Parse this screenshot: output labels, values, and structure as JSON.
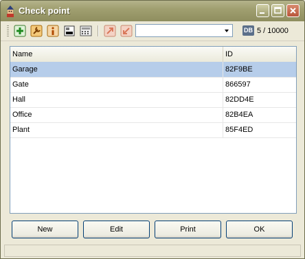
{
  "window": {
    "title": "Check point"
  },
  "toolbar": {
    "icons": [
      "add-icon",
      "wrench-icon",
      "info-icon",
      "card-reader-icon",
      "keypad-icon",
      "import-icon",
      "export-icon"
    ],
    "combo_value": "",
    "db_badge": "DB",
    "db_count": "5 / 10000"
  },
  "list": {
    "columns": [
      "Name",
      "ID"
    ],
    "rows": [
      {
        "name": "Garage",
        "id": "82F9BE",
        "selected": true
      },
      {
        "name": "Gate",
        "id": "866597",
        "selected": false
      },
      {
        "name": "Hall",
        "id": "82DD4E",
        "selected": false
      },
      {
        "name": "Office",
        "id": "82B4EA",
        "selected": false
      },
      {
        "name": "Plant",
        "id": "85F4ED",
        "selected": false
      }
    ]
  },
  "buttons": {
    "new": "New",
    "edit": "Edit",
    "print": "Print",
    "ok": "OK"
  },
  "colors": {
    "selection": "#b6cdea",
    "titlebar": "#a09f70"
  }
}
